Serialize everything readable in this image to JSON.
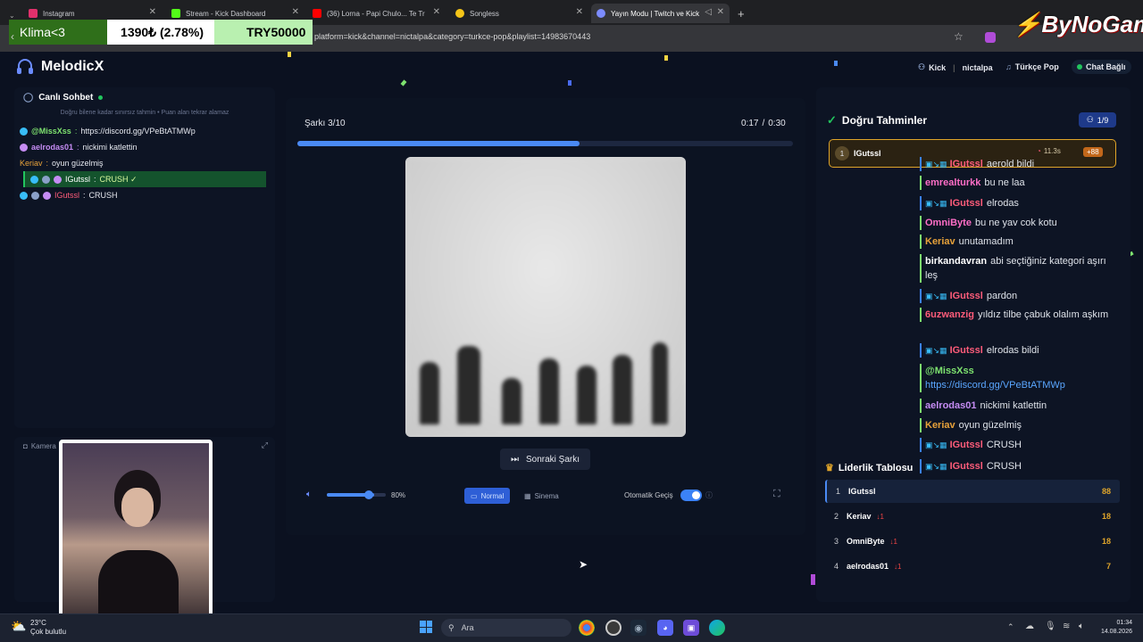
{
  "browser": {
    "tabs": [
      {
        "title": "Instagram",
        "color": "#e1306c"
      },
      {
        "title": "Stream - Kick Dashboard",
        "color": "#53fc18"
      },
      {
        "title": "(36) Lorna - Papi Chulo... Te Traigo",
        "color": "#ff0000"
      },
      {
        "title": "Songless",
        "color": "#f5c518"
      },
      {
        "title": "Yayın Modu | Twitch ve Kick",
        "color": "#7c8cff"
      }
    ],
    "url": "platform=kick&channel=nictalpa&category=turkce-pop&playlist=14983670443"
  },
  "overlay": {
    "stock_name": "Klima<3",
    "stock_value": "1390₺ (2.78%)",
    "stock_goal": "TRY50000",
    "watermark": "ByNoGam"
  },
  "app": {
    "name": "MelodicX",
    "platform": "Kick",
    "channel": "nictalpa",
    "category": "Türkçe Pop",
    "chat_status": "Chat Bağlı"
  },
  "live_chat": {
    "title": "Canlı Sohbet",
    "hint": "Doğru bilene kadar sınırsız tahmin • Puan alan tekrar alamaz",
    "messages": [
      {
        "user": "@MissXss",
        "text": "https://discord.gg/VPeBtATMWp",
        "color": "#7ee36f"
      },
      {
        "user": "aelrodas01",
        "text": "nickimi katlettin",
        "color": "#c58cf3"
      },
      {
        "user": "Keriav",
        "text": "oyun güzelmiş",
        "color": "#e8a23a"
      },
      {
        "user": "IGutssl",
        "text": "CRUSH ✓",
        "color": "#ffffff",
        "correct": true
      },
      {
        "user": "IGutssl",
        "text": "CRUSH",
        "color": "#ff5c7a"
      }
    ]
  },
  "camera": {
    "label": "Kamera"
  },
  "game": {
    "song_counter": "Şarkı 3/10",
    "time_current": "0:17",
    "time_sep": "/",
    "time_total": "0:30",
    "progress": 0.57,
    "next_label": "Sonraki Şarkı",
    "volume_pct": "80%",
    "volume": 0.8,
    "mode_normal": "Normal",
    "mode_cinema": "Sinema",
    "auto_label": "Otomatik Geçiş"
  },
  "guesses": {
    "title": "Doğru Tahminler",
    "count": "1/9",
    "winner": {
      "rank": "1",
      "user": "IGutssl",
      "time": "11.3s",
      "points": "+88"
    }
  },
  "side_chat": [
    {
      "user": "IGutssl",
      "text": "aerold bildi",
      "color": "#ff5c7a",
      "badges": true
    },
    {
      "user": "emrealturkk",
      "text": "bu ne laa",
      "color": "#ff6ec7"
    },
    {
      "user": "IGutssl",
      "text": "elrodas",
      "color": "#ff5c7a",
      "badges": true
    },
    {
      "user": "OmniByte",
      "text": "bu ne yav cok kotu",
      "color": "#ff6ec7"
    },
    {
      "user": "Keriav",
      "text": "unutamadım",
      "color": "#e8a23a"
    },
    {
      "user": "birkandavran",
      "text": "abi seçtiğiniz kategori aşırı leş",
      "color": "#ffffff"
    },
    {
      "user": "IGutssl",
      "text": "pardon",
      "color": "#ff5c7a",
      "badges": true
    },
    {
      "user": "6uzwanzig",
      "text": "yıldız tilbe çabuk olalım aşkım",
      "color": "#ff5c7a"
    },
    {
      "user": "IGutssl",
      "text": "elrodas bildi",
      "color": "#ff5c7a",
      "badges": true
    },
    {
      "user": "@MissXss",
      "text": "https://discord.gg/VPeBtATMWp",
      "color": "#7ee36f"
    },
    {
      "user": "aelrodas01",
      "text": "nickimi katlettin",
      "color": "#c58cf3"
    },
    {
      "user": "Keriav",
      "text": "oyun güzelmiş",
      "color": "#e8a23a"
    },
    {
      "user": "IGutssl",
      "text": "CRUSH",
      "color": "#ff5c7a",
      "badges": true
    },
    {
      "user": "IGutssl",
      "text": "CRUSH",
      "color": "#ff5c7a",
      "badges": true
    }
  ],
  "leaderboard": {
    "title": "Liderlik Tablosu",
    "rows": [
      {
        "rank": "1",
        "user": "IGutssl",
        "change": "",
        "score": "88"
      },
      {
        "rank": "2",
        "user": "Keriav",
        "change": "↓1",
        "score": "18"
      },
      {
        "rank": "3",
        "user": "OmniByte",
        "change": "↓1",
        "score": "18"
      },
      {
        "rank": "4",
        "user": "aelrodas01",
        "change": "↓1",
        "score": "7"
      }
    ]
  },
  "taskbar": {
    "weather_temp": "23°C",
    "weather_desc": "Çok bulutlu",
    "search": "Ara",
    "time": "01:34",
    "date": "14.08.2026"
  }
}
